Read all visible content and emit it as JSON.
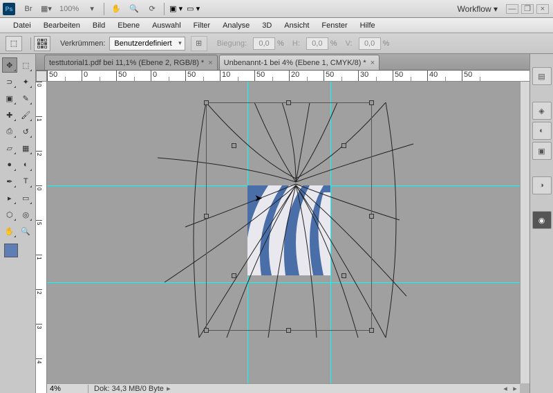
{
  "titlebar": {
    "zoom": "100%",
    "workflow": "Workflow ▾"
  },
  "menu": [
    "Datei",
    "Bearbeiten",
    "Bild",
    "Ebene",
    "Auswahl",
    "Filter",
    "Analyse",
    "3D",
    "Ansicht",
    "Fenster",
    "Hilfe"
  ],
  "options": {
    "label": "Verkrümmen:",
    "preset": "Benutzerdefiniert",
    "bend_label": "Biegung:",
    "bend_val": "0,0",
    "h_label": "H:",
    "h_val": "0,0",
    "v_label": "V:",
    "v_val": "0,0"
  },
  "tabs": [
    {
      "label": "testtutorial1.pdf bei 11,1% (Ebene 2, RGB/8) *"
    },
    {
      "label": "Unbenannt-1 bei 4% (Ebene 1, CMYK/8) *"
    }
  ],
  "ruler_h": [
    "50",
    "0",
    "50",
    "0",
    "50",
    "10",
    "50",
    "20",
    "50",
    "30",
    "50",
    "40",
    "50"
  ],
  "ruler_v": [
    "0",
    "1",
    "2",
    "0",
    "5",
    "1",
    "2",
    "3",
    "4"
  ],
  "status": {
    "zoom": "4%",
    "doc": "Dok: 34,3 MB/0 Byte"
  }
}
